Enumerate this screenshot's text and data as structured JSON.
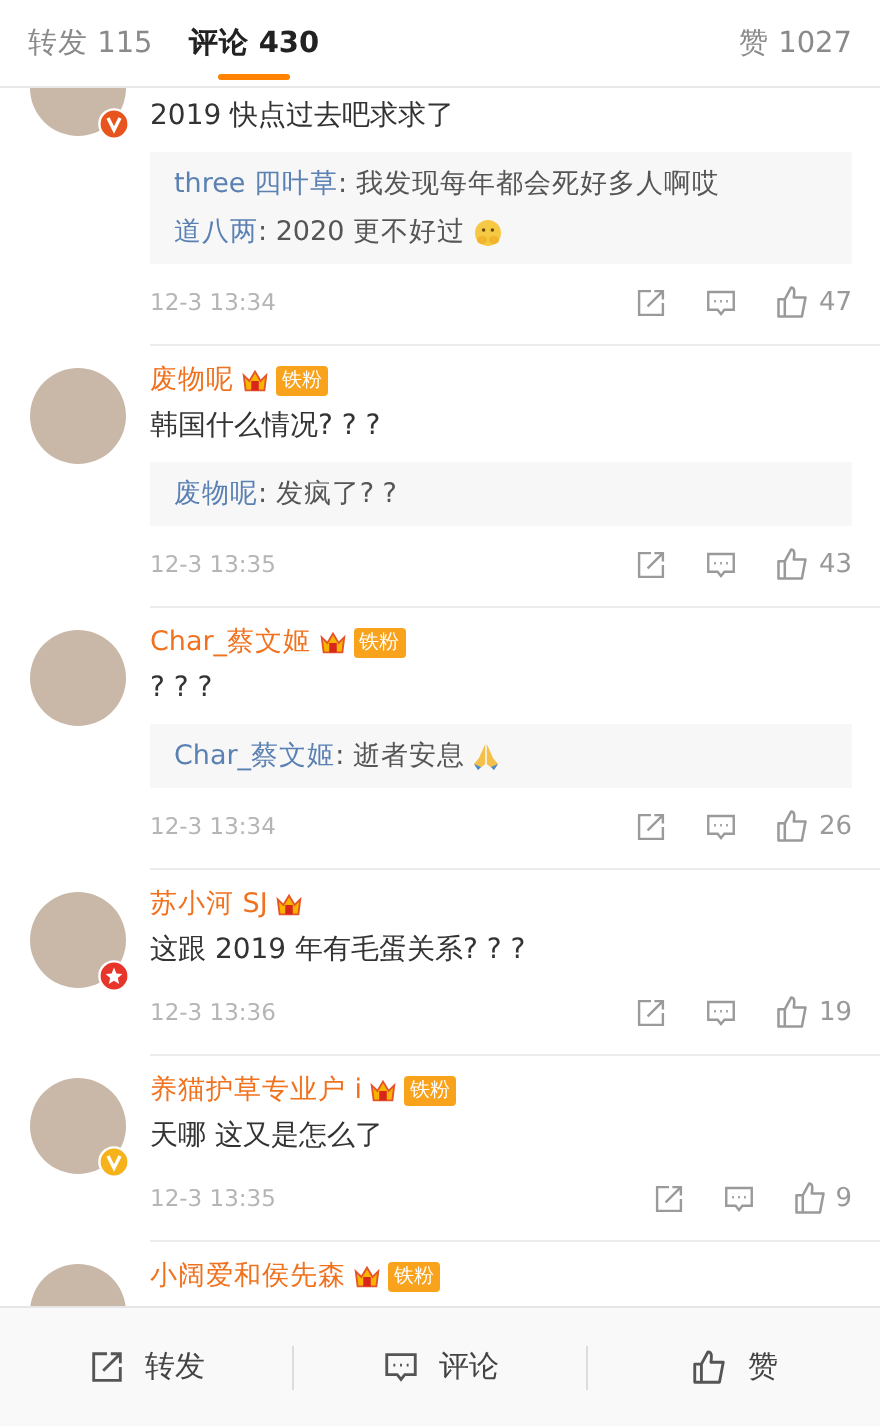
{
  "tabs": [
    {
      "label": "转发",
      "count": "115",
      "selected": false
    },
    {
      "label": "评论",
      "count": "430",
      "selected": true
    }
  ],
  "likes_tab": {
    "label": "赞",
    "count": "1027"
  },
  "comments": [
    {
      "verified": {
        "kind": "v",
        "color": "#e8541e"
      },
      "text": "2019 快点过去吧求求了",
      "replies": [
        {
          "kind": "plain",
          "user": "three 四叶草",
          "text": ": 我发现每年都会死好多人啊哎"
        },
        {
          "kind": "face",
          "user": "道八两",
          "text": ": 2020 更不好过"
        }
      ],
      "time": "12-3 13:34",
      "likes": "47"
    },
    {
      "name": "废物呢",
      "badge": "铁粉",
      "text": "韩国什么情况? ? ?",
      "replies": [
        {
          "kind": "plain",
          "user": "废物呢",
          "text": ": 发疯了? ?"
        }
      ],
      "time": "12-3 13:35",
      "likes": "43"
    },
    {
      "name": "Char_蔡文姬",
      "badge": "铁粉",
      "text": "? ? ?",
      "replies": [
        {
          "kind": "pray",
          "user": "Char_蔡文姬",
          "text": ": 逝者安息"
        }
      ],
      "time": "12-3 13:34",
      "likes": "26"
    },
    {
      "name": "苏小河 SJ",
      "verified": {
        "kind": "star",
        "color": "#e8352a"
      },
      "text": "这跟 2019 年有毛蛋关系? ? ?",
      "time": "12-3 13:36",
      "likes": "19"
    },
    {
      "name": "养猫护草专业户 i",
      "badge": "铁粉",
      "verified": {
        "kind": "v",
        "color": "#f6b21b"
      },
      "text": "天哪 这又是怎么了",
      "time": "12-3 13:35",
      "likes": "9"
    },
    {
      "name": "小阔爱和侯先森",
      "badge": "铁粉"
    }
  ],
  "bottom_bar": [
    {
      "kind": "repost",
      "label": "转发"
    },
    {
      "kind": "comment",
      "label": "评论"
    },
    {
      "kind": "like",
      "label": "赞"
    }
  ]
}
